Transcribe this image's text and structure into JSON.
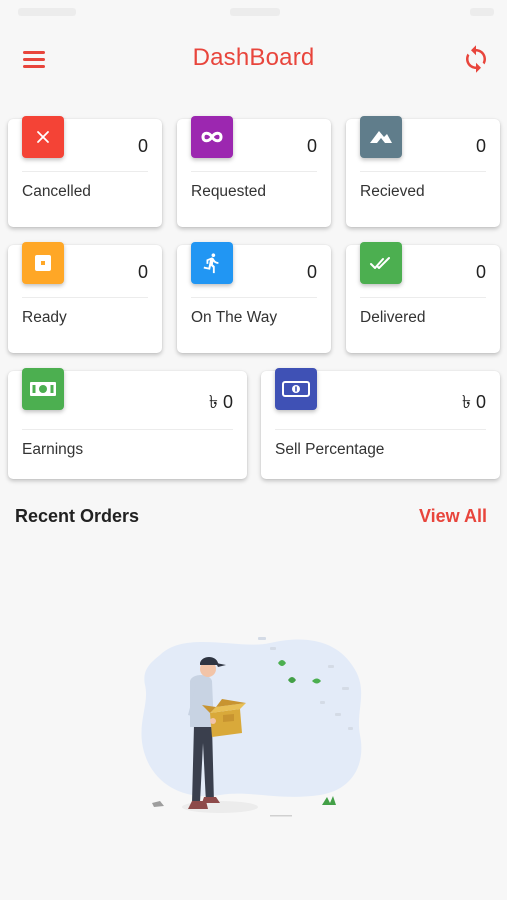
{
  "header": {
    "title": "DashBoard",
    "menu_icon": "hamburger-menu-icon",
    "refresh_icon": "refresh-icon"
  },
  "colors": {
    "accent": "#e8453c",
    "cancelled": "#f44336",
    "requested": "#9c27b0",
    "received": "#607d8b",
    "ready": "#ffa726",
    "on_the_way": "#2196f3",
    "delivered": "#4caf50",
    "earnings": "#4caf50",
    "sell_percentage": "#3f51b5"
  },
  "stats": {
    "cancelled": {
      "label": "Cancelled",
      "value": "0",
      "icon": "close-icon"
    },
    "requested": {
      "label": "Requested",
      "value": "0",
      "icon": "infinity-icon"
    },
    "received": {
      "label": "Recieved",
      "value": "0",
      "icon": "received-icon"
    },
    "ready": {
      "label": "Ready",
      "value": "0",
      "icon": "ready-icon"
    },
    "on_the_way": {
      "label": "On The Way",
      "value": "0",
      "icon": "running-person-icon"
    },
    "delivered": {
      "label": "Delivered",
      "value": "0",
      "icon": "double-check-icon"
    },
    "earnings": {
      "label": "Earnings",
      "value": "৳ 0",
      "icon": "money-icon"
    },
    "sell_percentage": {
      "label": "Sell Percentage",
      "value": "৳ 0",
      "icon": "money-icon"
    }
  },
  "recent_orders": {
    "title": "Recent Orders",
    "view_all": "View All",
    "empty_illustration": "empty-box-illustration"
  }
}
